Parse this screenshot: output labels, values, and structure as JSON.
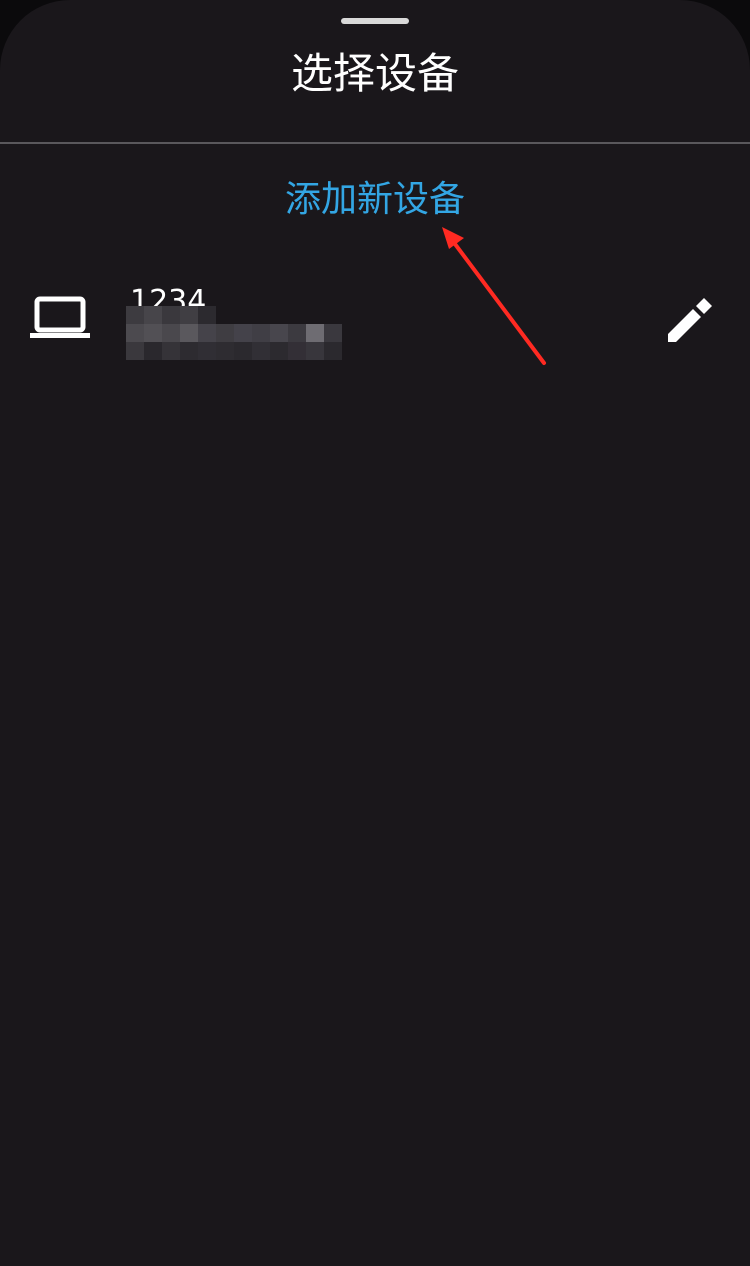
{
  "sheet": {
    "title": "选择设备"
  },
  "actions": {
    "add_device_label": "添加新设备"
  },
  "devices": [
    {
      "name": "1234",
      "icon": "laptop-icon",
      "detail_redacted": true,
      "action_icon": "pencil-icon"
    }
  ],
  "colors": {
    "sheet_background": "#1a171b",
    "accent": "#33a6e4",
    "annotation": "#ff2a22"
  }
}
